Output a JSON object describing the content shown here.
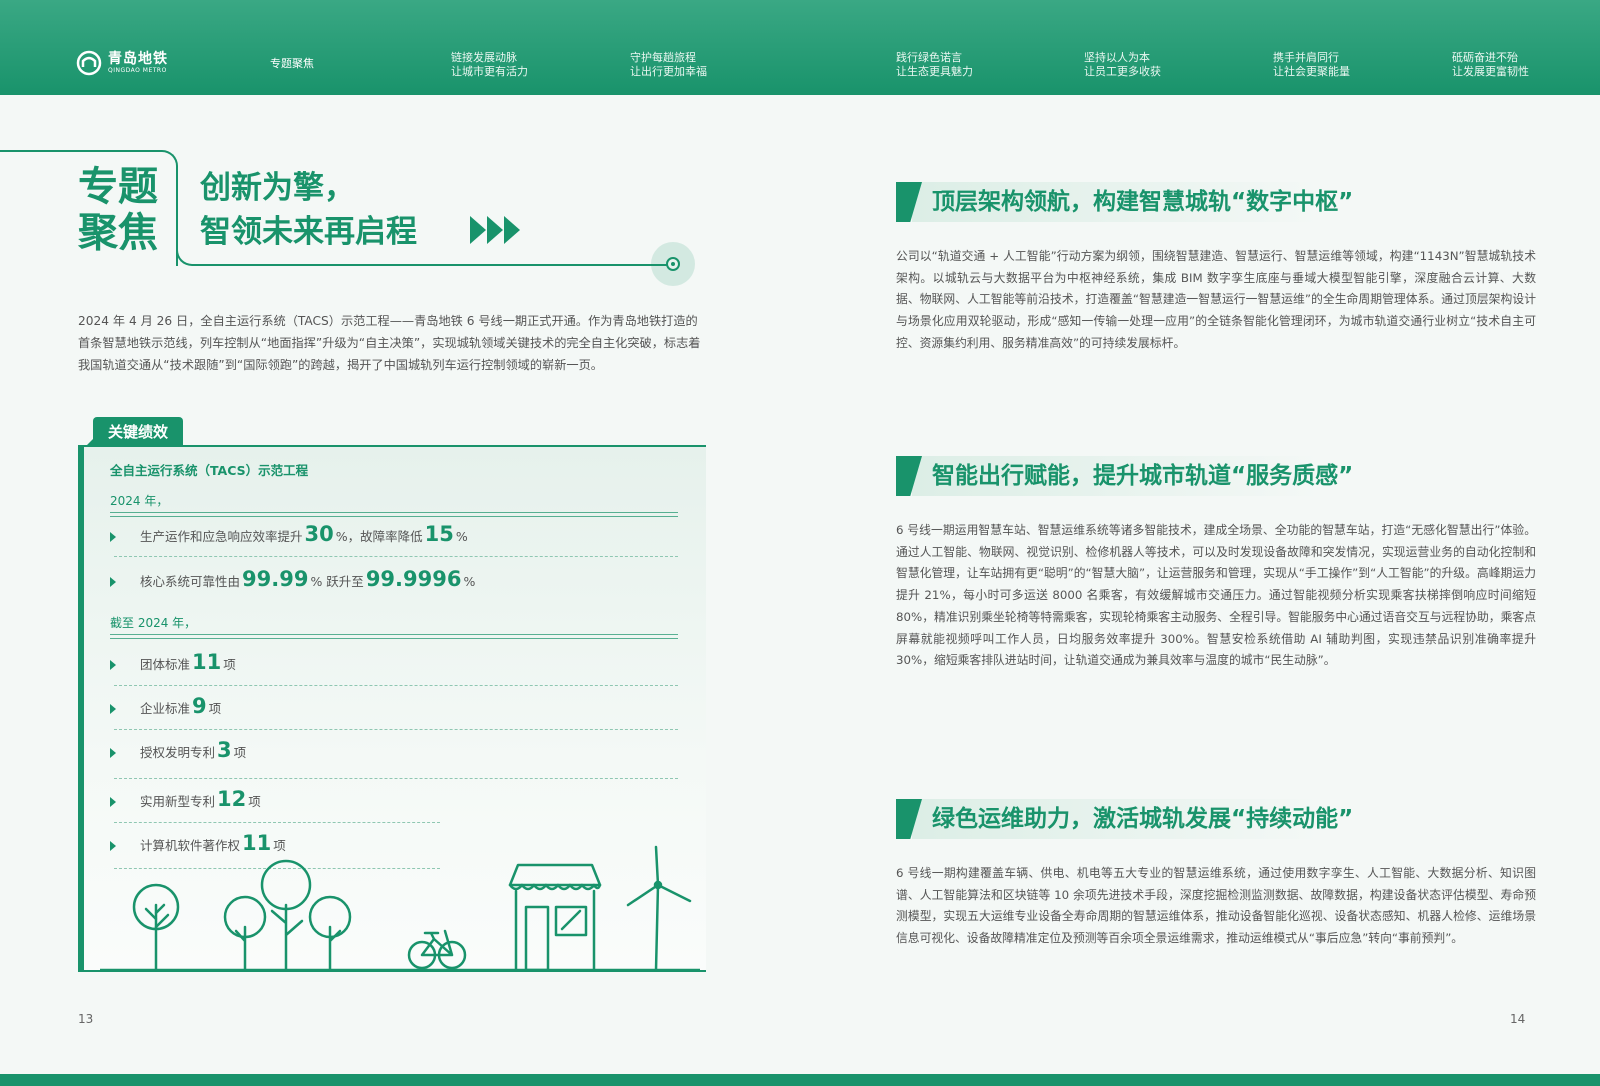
{
  "header": {
    "logo": {
      "cn": "青岛地铁",
      "en": "QINGDAO METRO"
    },
    "nav": [
      {
        "line1": "专题聚焦",
        "line2": ""
      },
      {
        "line1": "链接发展动脉",
        "line2": "让城市更有活力"
      },
      {
        "line1": "守护每趟旅程",
        "line2": "让出行更加幸福"
      },
      {
        "line1": "践行绿色诺言",
        "line2": "让生态更具魅力"
      },
      {
        "line1": "坚持以人为本",
        "line2": "让员工更多收获"
      },
      {
        "line1": "携手并肩同行",
        "line2": "让社会更聚能量"
      },
      {
        "line1": "砥砺奋进不殆",
        "line2": "让发展更富韧性"
      }
    ]
  },
  "left": {
    "label_line1": "专题",
    "label_line2": "聚焦",
    "title_line1": "创新为擎，",
    "title_line2": "智领未来再启程",
    "intro": "2024 年 4 月 26 日，全自主运行系统（TACS）示范工程——青岛地铁 6 号线一期正式开通。作为青岛地铁打造的首条智慧地铁示范线，列车控制从“地面指挥”升级为“自主决策”，实现城轨领域关键技术的完全自主化突破，标志着我国轨道交通从“技术跟随”到“国际领跑”的跨越，揭开了中国城轨列车运行控制领域的崭新一页。",
    "kpi": {
      "tab": "关键绩效",
      "heading": "全自主运行系统（TACS）示范工程",
      "year1": "2024 年，",
      "year2": "截至 2024 年，",
      "rows": [
        {
          "t1": "生产运作和应急响应效率提升 ",
          "n1": "30",
          "t2": "%，故障率降低 ",
          "n2": "15",
          "t3": "%"
        },
        {
          "t1": "核心系统可靠性由 ",
          "n1": "99.99",
          "t2": "% 跃升至 ",
          "n2": "99.9996",
          "t3": "%"
        },
        {
          "t1": "团体标准 ",
          "n1": "11",
          "t2": " 项",
          "n2": "",
          "t3": ""
        },
        {
          "t1": "企业标准 ",
          "n1": "9",
          "t2": " 项",
          "n2": "",
          "t3": ""
        },
        {
          "t1": "授权发明专利 ",
          "n1": "3",
          "t2": " 项",
          "n2": "",
          "t3": ""
        },
        {
          "t1": "实用新型专利 ",
          "n1": "12",
          "t2": " 项",
          "n2": "",
          "t3": ""
        },
        {
          "t1": "计算机软件著作权 ",
          "n1": "11",
          "t2": " 项",
          "n2": "",
          "t3": ""
        }
      ]
    },
    "page_number": "13"
  },
  "right": {
    "sections": [
      {
        "title": "顶层架构领航，构建智慧城轨“数字中枢”",
        "body": "公司以“轨道交通 + 人工智能”行动方案为纲领，围绕智慧建造、智慧运行、智慧运维等领域，构建“1143N”智慧城轨技术架构。以城轨云与大数据平台为中枢神经系统，集成 BIM 数字孪生底座与垂域大模型智能引擎，深度融合云计算、大数据、物联网、人工智能等前沿技术，打造覆盖“智慧建造一智慧运行一智慧运维”的全生命周期管理体系。通过顶层架构设计与场景化应用双轮驱动，形成“感知一传输一处理一应用”的全链条智能化管理闭环，为城市轨道交通行业树立“技术自主可控、资源集约利用、服务精准高效”的可持续发展标杆。"
      },
      {
        "title": "智能出行赋能，提升城市轨道“服务质感”",
        "body": "6 号线一期运用智慧车站、智慧运维系统等诸多智能技术，建成全场景、全功能的智慧车站，打造“无感化智慧出行”体验。通过人工智能、物联网、视觉识别、检修机器人等技术，可以及时发现设备故障和突发情况，实现运营业务的自动化控制和智慧化管理，让车站拥有更“聪明”的“智慧大脑”，让运营服务和管理，实现从“手工操作”到“人工智能”的升级。高峰期运力提升 21%，每小时可多运送 8000 名乘客，有效缓解城市交通压力。通过智能视频分析实现乘客扶梯摔倒响应时间缩短 80%，精准识别乘坐轮椅等特需乘客，实现轮椅乘客主动服务、全程引导。智能服务中心通过语音交互与远程协助，乘客点屏幕就能视频呼叫工作人员，日均服务效率提升 300%。智慧安检系统借助 AI 辅助判图，实现违禁品识别准确率提升 30%，缩短乘客排队进站时间，让轨道交通成为兼具效率与温度的城市“民生动脉”。"
      },
      {
        "title": "绿色运维助力，激活城轨发展“持续动能”",
        "body": "6 号线一期构建覆盖车辆、供电、机电等五大专业的智慧运维系统，通过使用数字孪生、人工智能、大数据分析、知识图谱、人工智能算法和区块链等 10 余项先进技术手段，深度挖掘检测监测数据、故障数据，构建设备状态评估模型、寿命预测模型，实现五大运维专业设备全寿命周期的智慧运维体系，推动设备智能化巡视、设备状态感知、机器人检修、运维场景信息可视化、设备故障精准定位及预测等百余项全景运维需求，推动运维模式从“事后应急”转向“事前预判”。"
      }
    ],
    "page_number": "14"
  },
  "colors": {
    "brand": "#19936b",
    "brand_light": "#3aa884",
    "panel_bg": "#e6f1ec"
  }
}
